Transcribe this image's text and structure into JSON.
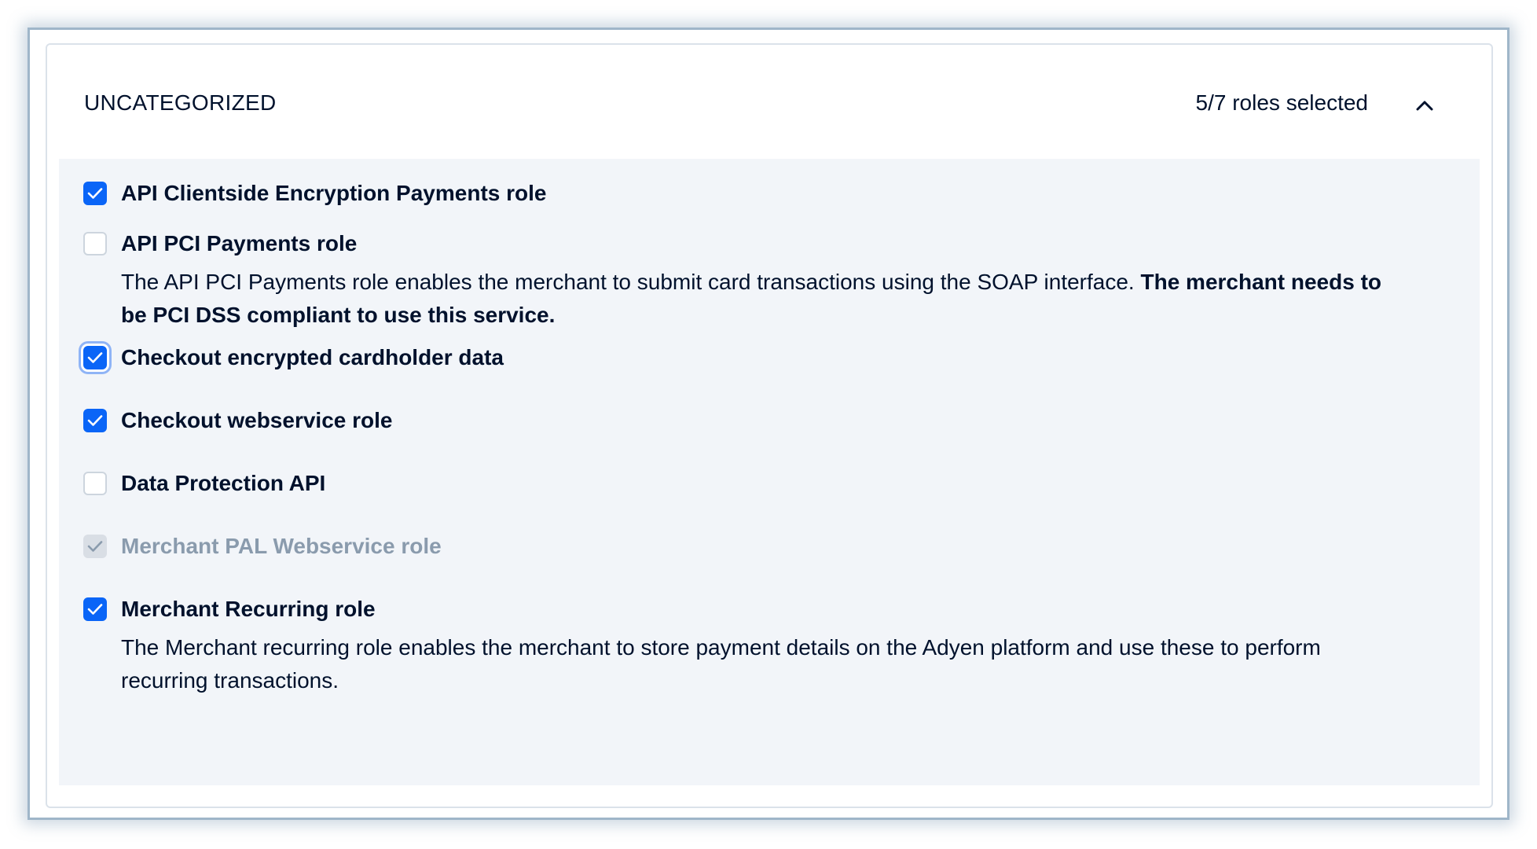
{
  "section": {
    "title": "UNCATEGORIZED",
    "roles_count": "5/7 roles selected",
    "toggle_icon": "chevron-up-icon"
  },
  "roles": [
    {
      "label": "API Clientside Encryption Payments role",
      "state": "checked"
    },
    {
      "label": "API PCI Payments role",
      "state": "unchecked",
      "description": "The API PCI Payments role enables the merchant to submit card transactions using the SOAP interface. ",
      "description_bold": "The merchant needs to be PCI DSS compliant to use this service."
    },
    {
      "label": "Checkout encrypted cardholder data",
      "state": "checked",
      "focused": true
    },
    {
      "label": "Checkout webservice role",
      "state": "checked"
    },
    {
      "label": "Data Protection API",
      "state": "unchecked"
    },
    {
      "label": "Merchant PAL Webservice role",
      "state": "checked-disabled"
    },
    {
      "label": "Merchant Recurring role",
      "state": "checked",
      "description": "The Merchant recurring role enables the merchant to store payment details on the Adyen platform and use these to perform recurring transactions."
    }
  ],
  "colors": {
    "checkbox_checked": "#0a65f7",
    "panel_background": "#f2f5f9",
    "disabled_text": "#8a9bad",
    "text": "#00112c"
  }
}
